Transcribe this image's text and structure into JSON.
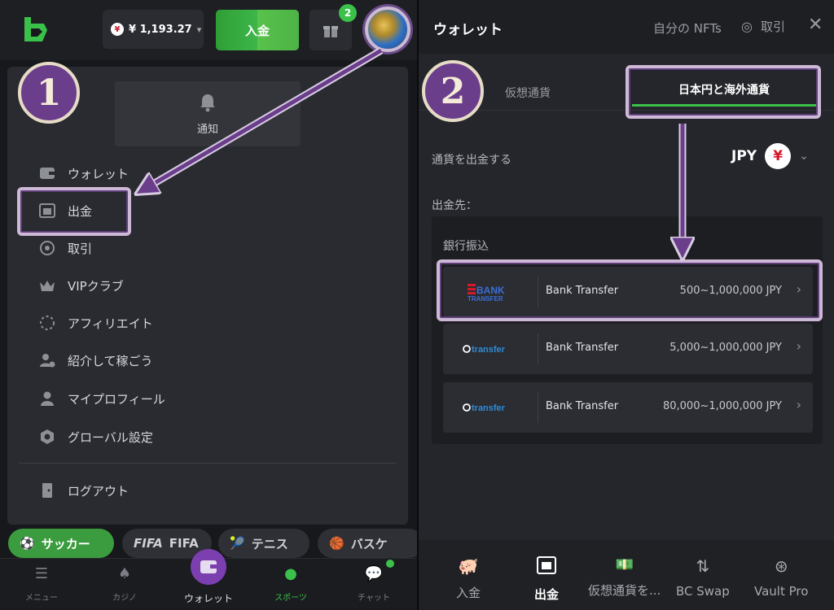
{
  "left": {
    "balance": "¥ 1,193.27",
    "deposit_label": "入金",
    "gift_count": "2",
    "notice_label": "通知",
    "menu": [
      {
        "label": "ウォレット",
        "icon": "wallet-icon"
      },
      {
        "label": "出金",
        "icon": "withdraw-icon"
      },
      {
        "label": "取引",
        "icon": "trade-icon"
      },
      {
        "label": "VIPクラブ",
        "icon": "crown-icon"
      },
      {
        "label": "アフィリエイト",
        "icon": "affiliate-icon"
      },
      {
        "label": "紹介して稼ごう",
        "icon": "refer-icon"
      },
      {
        "label": "マイプロフィール",
        "icon": "profile-icon"
      },
      {
        "label": "グローバル設定",
        "icon": "settings-icon"
      }
    ],
    "logout_label": "ログアウト",
    "sports": [
      "サッカー",
      "FIFA",
      "テニス",
      "バスケ"
    ],
    "bottom_nav": [
      "メニュー",
      "カジノ",
      "ウォレット",
      "スポーツ",
      "チャット"
    ],
    "step": "1"
  },
  "right": {
    "title": "ウォレット",
    "nfts": "自分の NFTs",
    "trade": "取引",
    "tabs": {
      "crypto": "仮想通貨",
      "fiat": "日本円と海外通貨"
    },
    "withdraw_currency_label": "通貨を出金する",
    "currency": "JPY",
    "currency_symbol": "¥",
    "destination_label": "出金先：",
    "bank_section": "銀行振込",
    "banks": [
      {
        "logo": "BANK TRANSFER",
        "name": "Bank Transfer",
        "range": "500~1,000,000 JPY"
      },
      {
        "logo": "transfer",
        "name": "Bank Transfer",
        "range": "5,000~1,000,000 JPY"
      },
      {
        "logo": "transfer",
        "name": "Bank Transfer",
        "range": "80,000~1,000,000 JPY"
      }
    ],
    "bottom_nav": [
      "入金",
      "出金",
      "仮想通貨を...",
      "BC Swap",
      "Vault Pro"
    ],
    "step": "2"
  },
  "colors": {
    "accent_green": "#3bc14a",
    "highlight_purple": "#6b3e8c",
    "yen_red": "#d3192a"
  }
}
